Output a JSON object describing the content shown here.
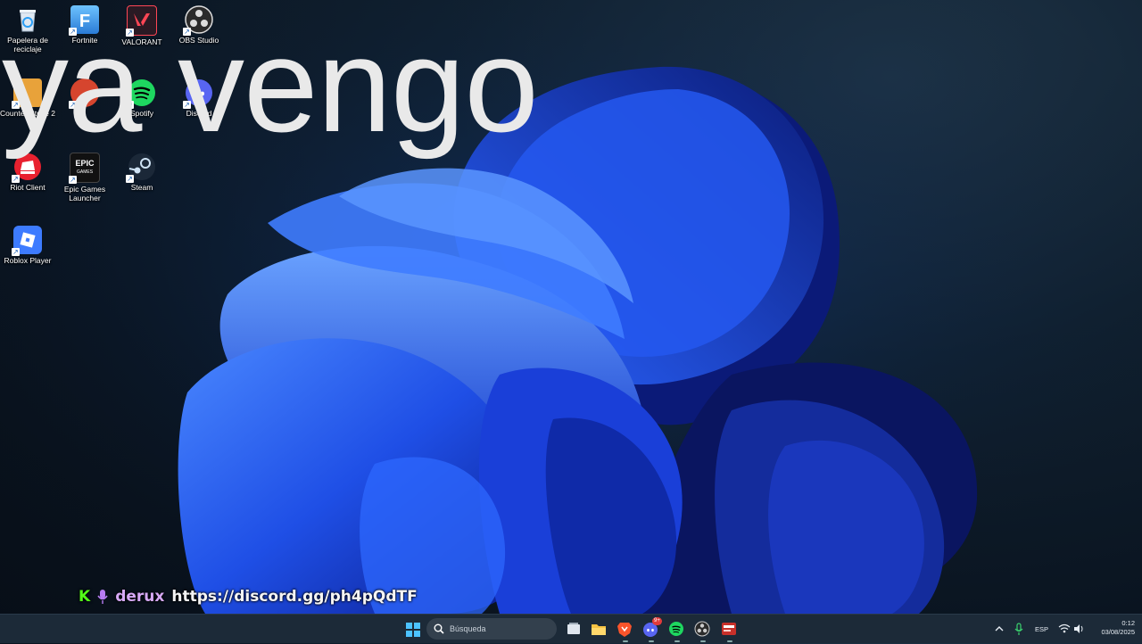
{
  "desktop": {
    "icons": [
      {
        "label": "Papelera de reciclaje",
        "icon": "recycle-bin-icon"
      },
      {
        "label": "Fortnite",
        "icon": "fortnite-icon"
      },
      {
        "label": "VALORANT",
        "icon": "valorant-icon"
      },
      {
        "label": "OBS Studio",
        "icon": "obs-icon"
      },
      {
        "label": "Counter-Strike 2",
        "icon": "cs2-icon"
      },
      {
        "label": "",
        "icon": "app-icon"
      },
      {
        "label": "Spotify",
        "icon": "spotify-icon"
      },
      {
        "label": "Discord",
        "icon": "discord-icon"
      },
      {
        "label": "Riot Client",
        "icon": "riot-client-icon"
      },
      {
        "label": "Epic Games Launcher",
        "icon": "epic-games-icon"
      },
      {
        "label": "Steam",
        "icon": "steam-icon"
      },
      {
        "label": "Roblox Player",
        "icon": "roblox-icon"
      }
    ]
  },
  "overlay": {
    "big_text": "ya vengo"
  },
  "stream_bar": {
    "platform_glyph": "K",
    "username": "derux",
    "link": "https://discord.gg/ph4pQdTF"
  },
  "taskbar": {
    "search_placeholder": "Búsqueda",
    "language": "ESP",
    "time": "0:12",
    "date": "03/08/2025",
    "discord_badge": "9+",
    "pinned": [
      "start-icon",
      "search-icon",
      "task-view-icon",
      "file-explorer-icon",
      "brave-icon",
      "discord-icon",
      "spotify-icon",
      "obs-icon",
      "app-icon"
    ]
  },
  "colors": {
    "accent": "#1f5bff",
    "kick_green": "#53fc18",
    "username": "#d6a9f5"
  }
}
